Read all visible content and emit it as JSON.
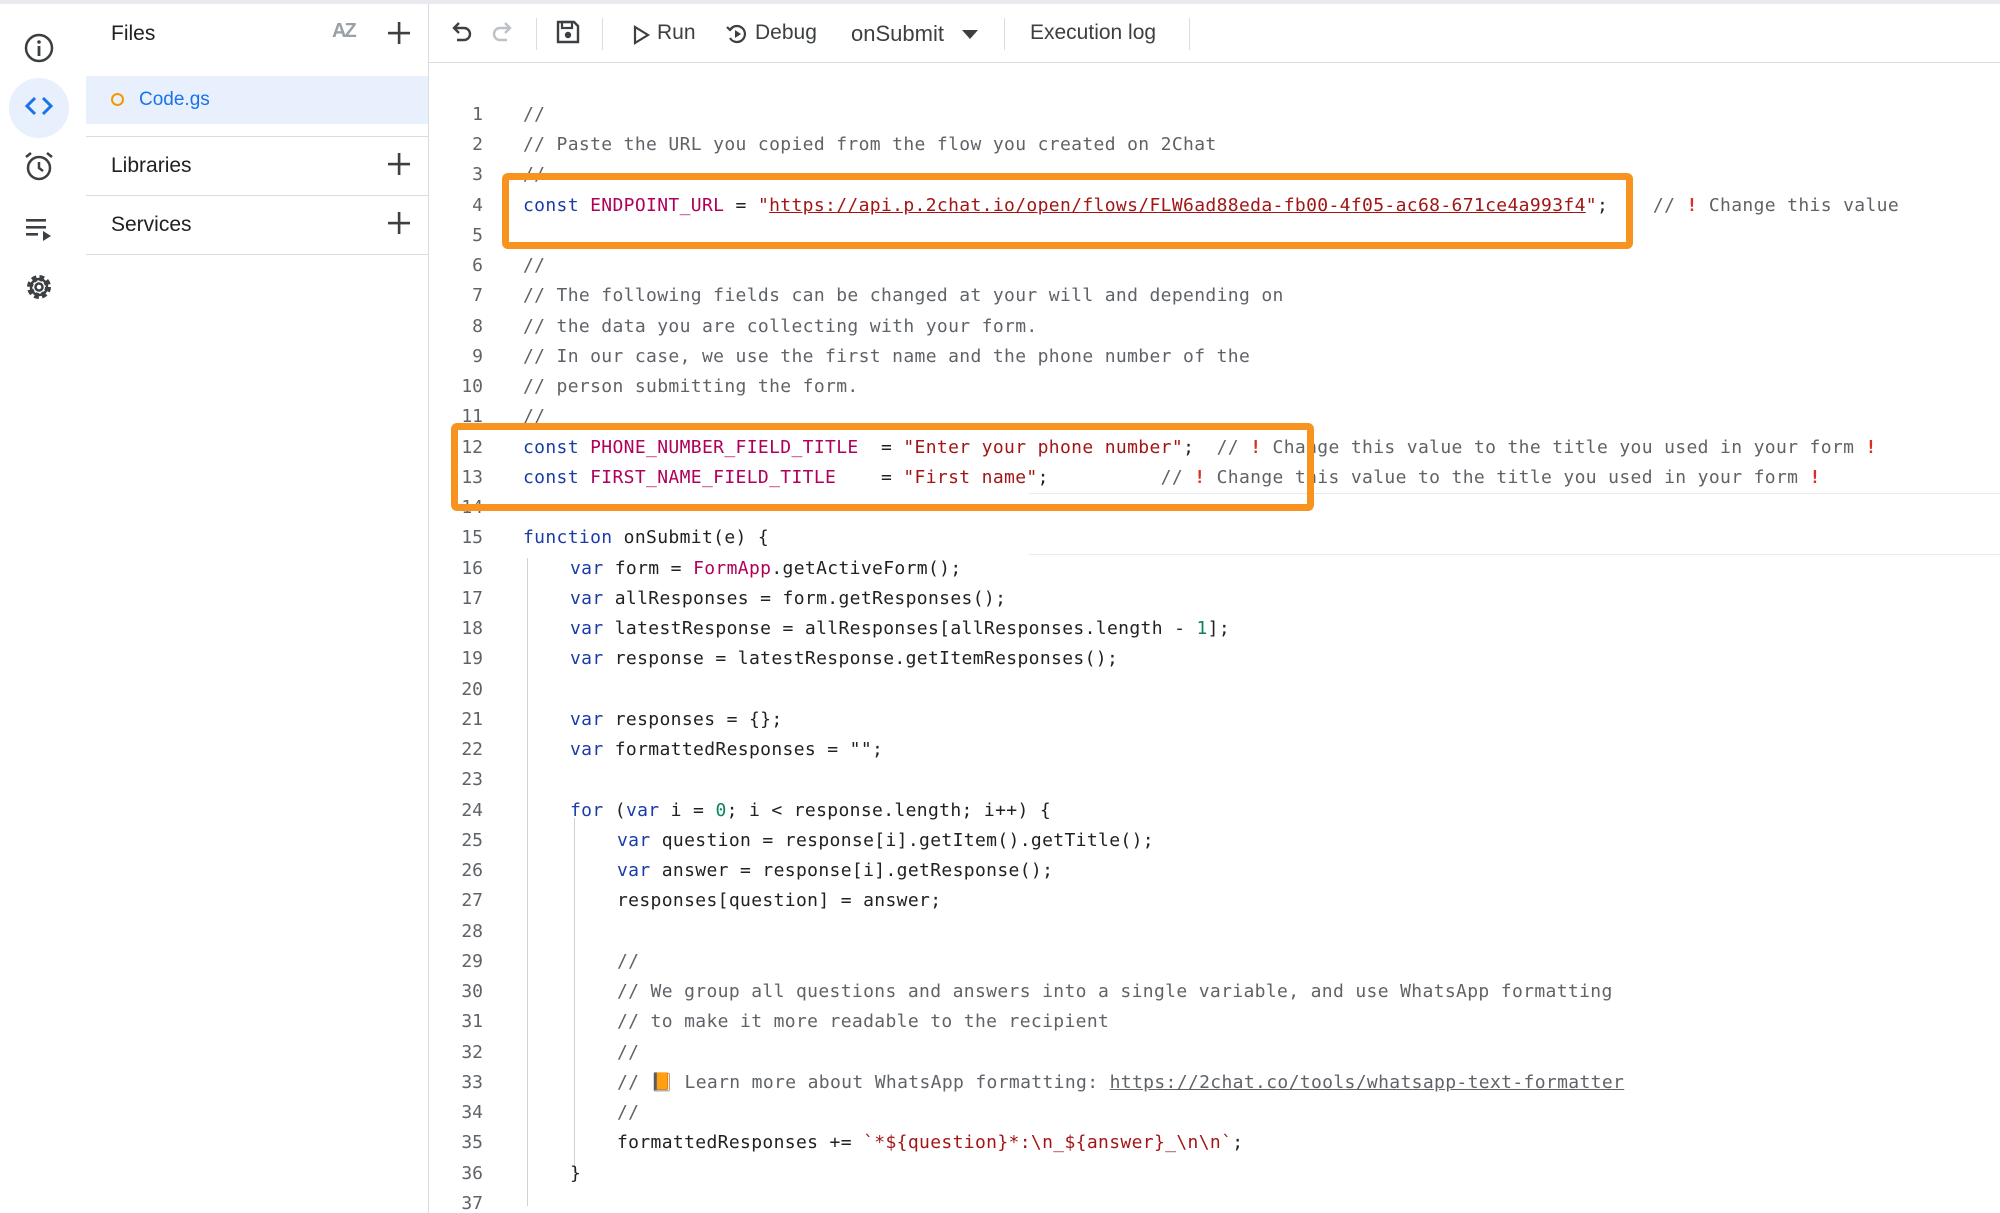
{
  "files_panel": {
    "title": "Files",
    "sort_label": "AZ",
    "active_file": "Code.gs",
    "sections": [
      {
        "label": "Libraries"
      },
      {
        "label": "Services"
      }
    ]
  },
  "toolbar": {
    "run_label": "Run",
    "debug_label": "Debug",
    "function_selected": "onSubmit",
    "execution_log_label": "Execution log"
  },
  "code": {
    "l1": "//",
    "l2": "// Paste the URL you copied from the flow you created on 2Chat",
    "l3": "//",
    "l4_kw": "const",
    "l4_name": "ENDPOINT_URL",
    "l4_eq": " = ",
    "l4_url": "https://api.p.2chat.io/open/flows/FLW6ad88eda-fb00-4f05-ac68-671ce4a993f4",
    "l4_end": ";",
    "l4_comment": "    // ",
    "l4_comment_text": " Change this value",
    "l6": "//",
    "l7": "// The following fields can be changed at your will and depending on",
    "l8": "// the data you are collecting with your form.",
    "l9": "// In our case, we use the first name and the phone number of the",
    "l10": "// person submitting the form.",
    "l11": "//",
    "l12_kw": "const",
    "l12_name": "PHONE_NUMBER_FIELD_TITLE",
    "l12_eq": "  = ",
    "l12_str": "\"Enter your phone number\"",
    "l12_end": ";",
    "l12_comment": "  // ",
    "l12_text": " Change this value to the title you used in your form ",
    "l13_kw": "const",
    "l13_name": "FIRST_NAME_FIELD_TITLE",
    "l13_eq": "    = ",
    "l13_str": "\"First name\"",
    "l13_end": ";",
    "l13_comment": "          // ",
    "l13_text": " Change this value to the title you used in your form ",
    "warn_glyph": "!",
    "l15_kw": "function",
    "l15_rest": " onSubmit(e) {",
    "l16_kw": "var",
    "l16_a": " form = ",
    "l16_b": "FormApp",
    "l16_c": ".getActiveForm();",
    "l17_kw": "var",
    "l17_rest": " allResponses = form.getResponses();",
    "l18_kw": "var",
    "l18_a": " latestResponse = allResponses[allResponses.length - ",
    "l18_num": "1",
    "l18_b": "];",
    "l19_kw": "var",
    "l19_rest": " response = latestResponse.getItemResponses();",
    "l21_kw": "var",
    "l21_rest": " responses = {};",
    "l22_kw": "var",
    "l22_rest": " formattedResponses = \"\";",
    "l24_kw": "for",
    "l24_a": " (",
    "l24_kw2": "var",
    "l24_b": " i = ",
    "l24_num": "0",
    "l24_c": "; i < response.length; i++) {",
    "l25_kw": "var",
    "l25_rest": " question = response[i].getItem().getTitle();",
    "l26_kw": "var",
    "l26_rest": " answer = response[i].getResponse();",
    "l27": "responses[question] = answer;",
    "l29": "//",
    "l30": "// We group all questions and answers into a single variable, and use WhatsApp formatting",
    "l31": "// to make it more readable to the recipient",
    "l32": "//",
    "l33_a": "// ",
    "l33_emoji": "📙",
    "l33_b": " Learn more about WhatsApp formatting: ",
    "l33_url": "https://2chat.co/tools/whatsapp-text-formatter",
    "l34": "//",
    "l35_a": "formattedResponses += ",
    "l35_str": "`*${question}*:\\n_${answer}_\\n\\n`",
    "l35_b": ";",
    "l36": "}"
  },
  "colors": {
    "accent": "#1a73e8",
    "highlight_box": "#f7931e",
    "warning": "#d93025"
  }
}
